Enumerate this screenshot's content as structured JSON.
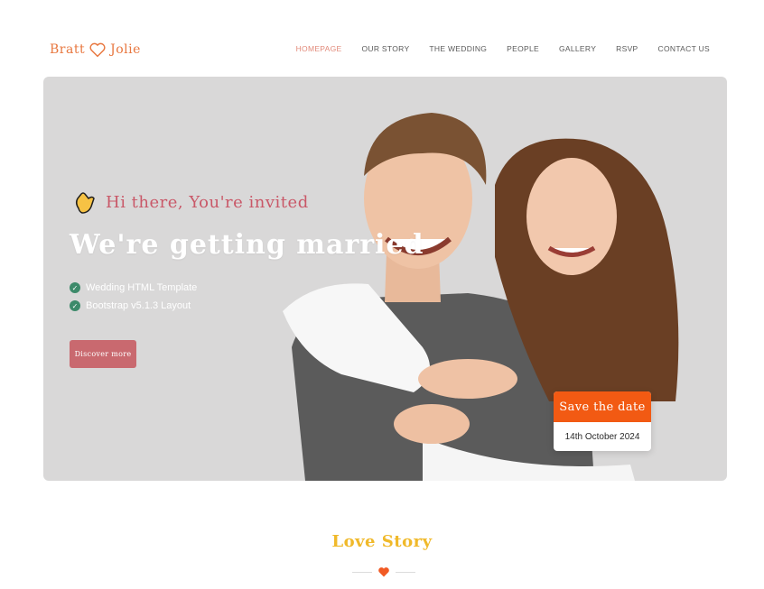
{
  "brand": {
    "name_left": "Bratt",
    "name_right": "Jolie",
    "color": "#e8773f"
  },
  "nav": {
    "items": [
      {
        "label": "HOMEPAGE",
        "active": true
      },
      {
        "label": "OUR STORY"
      },
      {
        "label": "THE WEDDING"
      },
      {
        "label": "PEOPLE"
      },
      {
        "label": "GALLERY"
      },
      {
        "label": "RSVP"
      },
      {
        "label": "CONTACT US"
      }
    ]
  },
  "hero": {
    "greeting": "Hi there, You're invited",
    "greeting_icon": "waving-hand-icon",
    "headline": "We're getting married",
    "features": [
      {
        "label": "Wedding HTML Template",
        "icon": "check-circle-icon"
      },
      {
        "label": "Bootstrap v5.1.3 Layout",
        "icon": "check-circle-icon"
      }
    ],
    "cta_label": "Discover more",
    "save_the_date": {
      "title": "Save the date",
      "date": "14th October 2024"
    },
    "colors": {
      "background": "#d9d8d8",
      "accent": "#c9696f",
      "save_header": "#f25a13",
      "check": "#3d8a6a"
    }
  },
  "love_story": {
    "title": "Love Story",
    "icon": "heart-icon",
    "color": "#f0b92a"
  }
}
